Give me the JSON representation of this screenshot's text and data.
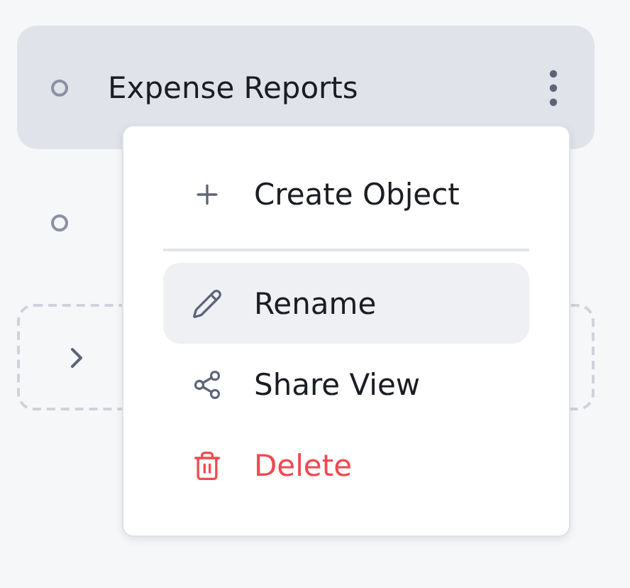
{
  "sidebar": {
    "items": [
      {
        "label": "Expense Reports",
        "selected": true
      },
      {
        "selected": false
      }
    ],
    "group": {
      "expanded": false
    }
  },
  "context_menu": {
    "items": [
      {
        "label": "Create Object",
        "kind": "normal",
        "selected": false,
        "divider_after": true
      },
      {
        "label": "Rename",
        "kind": "normal",
        "selected": true,
        "divider_after": false
      },
      {
        "label": "Share View",
        "kind": "normal",
        "selected": false,
        "divider_after": false
      },
      {
        "label": "Delete",
        "kind": "danger",
        "selected": false,
        "divider_after": false
      }
    ]
  }
}
